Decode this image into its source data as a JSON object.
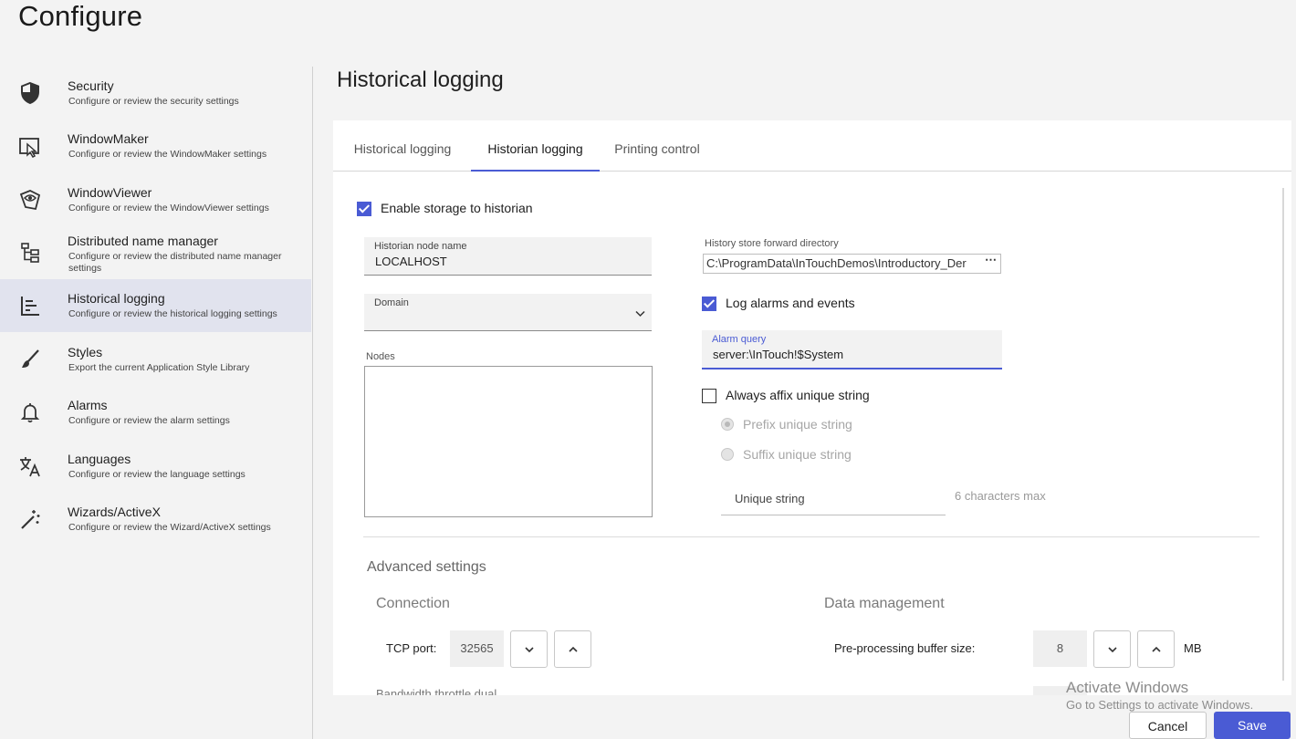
{
  "app_title": "Configure",
  "sidebar": {
    "items": [
      {
        "title": "Security",
        "desc": "Configure or review the security settings",
        "icon": "shield-icon"
      },
      {
        "title": "WindowMaker",
        "desc": "Configure or review the WindowMaker settings",
        "icon": "window-maker-icon"
      },
      {
        "title": "WindowViewer",
        "desc": "Configure or review the WindowViewer settings",
        "icon": "window-viewer-icon"
      },
      {
        "title": "Distributed name manager",
        "desc": "Configure or review the distributed name manager settings",
        "icon": "hierarchy-icon"
      },
      {
        "title": "Historical logging",
        "desc": "Configure or review the historical logging settings",
        "icon": "log-chart-icon"
      },
      {
        "title": "Styles",
        "desc": "Export the current Application Style Library",
        "icon": "brush-icon"
      },
      {
        "title": "Alarms",
        "desc": "Configure or review the alarm settings",
        "icon": "bell-icon"
      },
      {
        "title": "Languages",
        "desc": "Configure or review the language settings",
        "icon": "translate-icon"
      },
      {
        "title": "Wizards/ActiveX",
        "desc": "Configure or review the Wizard/ActiveX settings",
        "icon": "magic-wand-icon"
      }
    ],
    "active_index": 4
  },
  "main": {
    "title": "Historical logging",
    "tabs": [
      {
        "label": "Historical logging"
      },
      {
        "label": "Historian logging"
      },
      {
        "label": "Printing control"
      }
    ],
    "active_tab": 1
  },
  "form": {
    "enable_storage_label": "Enable storage to historian",
    "enable_storage_checked": true,
    "historian_node": {
      "label": "Historian node name",
      "value": "LOCALHOST"
    },
    "domain": {
      "label": "Domain",
      "value": ""
    },
    "nodes_label": "Nodes",
    "history_dir": {
      "label": "History store forward directory",
      "value": "C:\\ProgramData\\InTouchDemos\\Introductory_Der"
    },
    "log_alarms_label": "Log alarms and events",
    "log_alarms_checked": true,
    "alarm_query": {
      "label": "Alarm query",
      "value": "server:\\InTouch!$System"
    },
    "affix_label": "Always affix unique string",
    "affix_checked": false,
    "prefix_label": "Prefix unique string",
    "suffix_label": "Suffix unique string",
    "unique_string_placeholder": "Unique string",
    "max_hint": "6 characters max"
  },
  "advanced": {
    "title": "Advanced settings",
    "connection_title": "Connection",
    "tcp_label": "TCP port:",
    "tcp_value": "32565",
    "data_title": "Data management",
    "buffer_label": "Pre-processing buffer size:",
    "buffer_value": "8",
    "buffer_unit": "MB",
    "cut_off_text": "Bandwidth throttle dual"
  },
  "watermark": {
    "line1": "Activate Windows",
    "line2": "Go to Settings to activate Windows."
  },
  "buttons": {
    "cancel": "Cancel",
    "save": "Save"
  },
  "colors": {
    "accent": "#4a5bd4",
    "active_sidebar_bg": "#e1e3ee"
  }
}
